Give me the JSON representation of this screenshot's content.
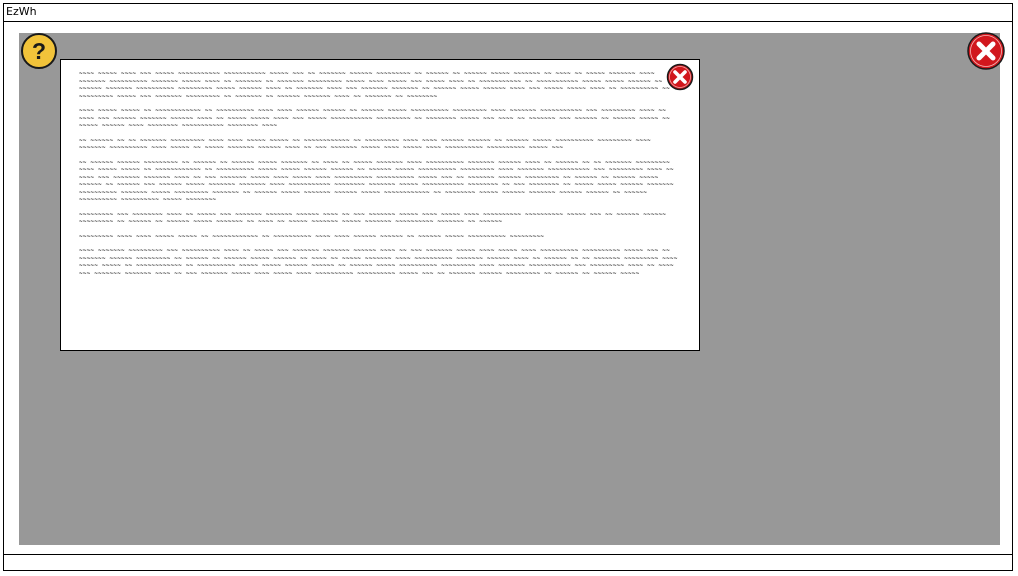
{
  "window": {
    "title": "EzWh"
  },
  "icons": {
    "help": "question-mark-icon",
    "close_main": "close-x-icon",
    "close_dialog": "close-x-icon"
  },
  "colors": {
    "overlay": "#989898",
    "help_fill": "#f2c33a",
    "close_fill": "#d1171d"
  },
  "dialog": {
    "paragraphs": [
      "~~~~ ~~~~~ ~~~~ ~~~ ~~~~~ ~~~~~~~~~~~ ~~~~~~~~~~~ ~~~~~ ~~~ ~~ ~~~~~~~ ~~~~~~ ~~~~~~~~~ ~~ ~~~~~~ ~~ ~~~~~~ ~~~~~ ~~~~~~~ ~~ ~~~~ ~~ ~~~~~ ~~~~~~~ ~~~~ ~~~~~~~ ~~~~~~~~~~ ~~~~~~~ ~~~~~ ~~~~ ~~ ~~~~~~~ ~~ ~~~~~~~ ~~~~~~~~~ ~~~~~ ~~~~ ~~~~~ ~~~ ~~~~~ ~~~~ ~~ ~~~~~~~~~~~ ~~ ~~~~~~~~~~~ ~~~~~ ~~~~~ ~~~~~~ ~~ ~~~~~~ ~~~~~~~ ~~~~~~~~~~ ~~~~~~~~~ ~~~~~ ~~~~~~ ~~~~ ~~ ~~~~~~~ ~~~~ ~~~ ~~~~~~~ ~~~~~~~ ~~ ~~~~~~ ~~~~~ ~~~~~~ ~~~~ ~~~ ~~~~~ ~~~~~ ~~~~ ~~ ~~~~~~~~~~ ~~ ~~~~~~~~~ ~~~~~ ~~~ ~~~~~~~ ~~~~~~~~~ ~~ ~~~~~~~ ~~ ~~~~~~ ~~~~~~~ ~~~~ ~~ ~~~~~~~ ~~ ~~~~~~~~",
      "~~~~ ~~~~~ ~~~~~ ~~ ~~~~~~~~~~~~ ~~ ~~~~~~~~~~ ~~~~ ~~~~ ~~~~~~ ~~~~~~ ~~ ~~~~~~ ~~~~~ ~~~~~~~~~~ ~~~~~~~~~ ~~~~ ~~~~~~~ ~~~~~~~~~~~ ~~~ ~~~~~~~~~ ~~~~ ~~ ~~~~ ~~~ ~~~~~~ ~~~~~~~ ~~~~~~ ~~~~ ~~ ~~~~~ ~~~~~ ~~~~ ~~~ ~~~~~ ~~~~~~~~~~~ ~~~~~~~~~ ~~ ~~~~~~~~ ~~~~~ ~~~ ~~~~ ~~ ~~~~~~~ ~~~ ~~~~~~ ~~ ~~~~~~ ~~~~~ ~~ ~~~~~ ~~~~~~ ~~~~ ~~~~~~~~ ~~~~~~~~~~~ ~~~~~~~~ ~~~~",
      "~~ ~~~~~~ ~~ ~~ ~~~~~~~ ~~~~~~~~~ ~~~~ ~~~~ ~~~~~ ~~~~~ ~~ ~~~~~~~~~~~~ ~~ ~~~~~~~~~ ~~~~ ~~~~ ~~~~~~ ~~~~~~ ~~ ~~~~~~ ~~~~~ ~~~~~~~~~~ ~~~~~~~~~ ~~~~ ~~~~~~~ ~~~~~~~~~~ ~~~~ ~~~~~ ~~ ~~~~~ ~~~~~~~ ~~~~~~ ~~~~ ~~ ~~~ ~~~~~~~ ~~~~~ ~~~~ ~~~~~ ~~~~ ~~~~~~~~~~ ~~~~~~~~~~ ~~~~~ ~~~",
      "~~ ~~~~~~ ~~~~~~ ~~~~~~~~~ ~~ ~~~~~~ ~~ ~~~~~~ ~~~~~ ~~~~~~~ ~~ ~~~~ ~~ ~~~~~ ~~~~~~~ ~~~~ ~~~~~~~~~~ ~~~~~~~ ~~~~~~ ~~~~ ~~ ~~~~~~ ~~ ~~ ~~~~~~~ ~~~~~~~~~ ~~~~ ~~~~~ ~~~~~ ~~ ~~~~~~~~~~~~ ~~ ~~~~~~~~~~ ~~~~~ ~~~~~ ~~~~~~ ~~~~~~ ~~ ~~~~~~ ~~~~~ ~~~~~~~~~~ ~~~~~~~~~ ~~~~ ~~~~~~~ ~~~~~~~~~~~ ~~~ ~~~~~~~~~ ~~~~ ~~ ~~~~ ~~~ ~~~~~~~ ~~~~~~~ ~~~~ ~~ ~~~ ~~~~~~~ ~~~~~ ~~~~ ~~~~~ ~~~~ ~~~~~~~~~~ ~~~~~~~~~~ ~~~~~ ~~~ ~~ ~~~~~~~ ~~~~~~ ~~~~~~~~~ ~~ ~~~~~~ ~~ ~~~~~~ ~~~~~ ~~~~~~ ~~ ~~~~~~ ~~~ ~~~~~~ ~~~~~ ~~~~~~~ ~~~~~~~ ~~~~ ~~~~~~~~~~~ ~~~~~~~~ ~~~~~~~ ~~~~~ ~~~~~~~~~~~ ~~~~~~~~ ~~ ~~~ ~~~~~~~~ ~~ ~~~~~ ~~~~~ ~~~~~~ ~~~~~~~ ~~~~~~~~~~ ~~~~~~~ ~~~~~ ~~~~~~~~~ ~~~~~~~ ~~ ~~~~~~ ~~~~~ ~~~~~~~ ~~~~~~ ~~~~~ ~~~~~~~~~~~~ ~~ ~~~~~~~~ ~~~~~ ~~~~~~ ~~~~~~~ ~~~~~~ ~~~~~~ ~~ ~~~~~~ ~~~~~~~~~~ ~~~~~~~~~~ ~~~~~ ~~~~~~~~",
      "~~~~~~~~~ ~~~ ~~~~~~~~ ~~~~ ~~ ~~~~~ ~~~ ~~~~~~~ ~~~~~~~ ~~~~~~ ~~~~ ~~ ~~~ ~~~~~~~ ~~~~~ ~~~~ ~~~~~ ~~~~ ~~~~~~~~~~ ~~~~~~~~~~ ~~~~~ ~~~ ~~ ~~~~~~ ~~~~~~ ~~~~~~~~~ ~~ ~~~~~~ ~~ ~~~~~~ ~~~~~ ~~~~~~~ ~~ ~~~~ ~~ ~~~~~ ~~~~~~~ ~~~~~ ~~~~~~~ ~~~~~~~~~~ ~~~~~~~ ~~ ~~~~~~",
      "~~~~~~~~~ ~~~~ ~~~~ ~~~~~ ~~~~~ ~~ ~~~~~~~~~~~~ ~~ ~~~~~~~~~~ ~~~~ ~~~~ ~~~~~~ ~~~~~~ ~~ ~~~~~~ ~~~~~ ~~~~~~~~~~ ~~~~~~~~~",
      "~~~~ ~~~~~~~ ~~~~~~~~~ ~~~ ~~~~~~~~~~ ~~~~ ~~ ~~~~~ ~~~ ~~~~~~~ ~~~~~~~ ~~~~~~ ~~~~ ~~ ~~~ ~~~~~~~ ~~~~~ ~~~~ ~~~~~ ~~~~ ~~~~~~~~~~ ~~~~~~~~~~ ~~~~~ ~~~ ~~ ~~~~~~~ ~~~~~~ ~~~~~~~~~ ~~ ~~~~~~ ~~ ~~~~~~ ~~~~~ ~~~~~~ ~~ ~~~~ ~~ ~~~~~ ~~~~~~~ ~~~~ ~~~~~~~~~~ ~~~~~~~ ~~~~~~ ~~~~ ~~ ~~~~~~ ~~ ~~ ~~~~~~~ ~~~~~~~~~ ~~~~ ~~~~~ ~~~~~ ~~ ~~~~~~~~~~~~ ~~ ~~~~~~~~~~ ~~~~~ ~~~~~ ~~~~~~ ~~~~~~ ~~ ~~~~~~ ~~~~~ ~~~~~~~~~~ ~~~~~~~~~ ~~~~ ~~~~~~~ ~~~~~~~~~~~ ~~~ ~~~~~~~~~ ~~~~ ~~ ~~~~ ~~~ ~~~~~~~ ~~~~~~~ ~~~~ ~~ ~~~ ~~~~~~~ ~~~~~ ~~~~ ~~~~~ ~~~~ ~~~~~~~~~~ ~~~~~~~~~~ ~~~~~ ~~~ ~~ ~~~~~~~ ~~~~~~ ~~~~~~~~~ ~~ ~~~~~~ ~~ ~~~~~~ ~~~~~"
    ]
  }
}
